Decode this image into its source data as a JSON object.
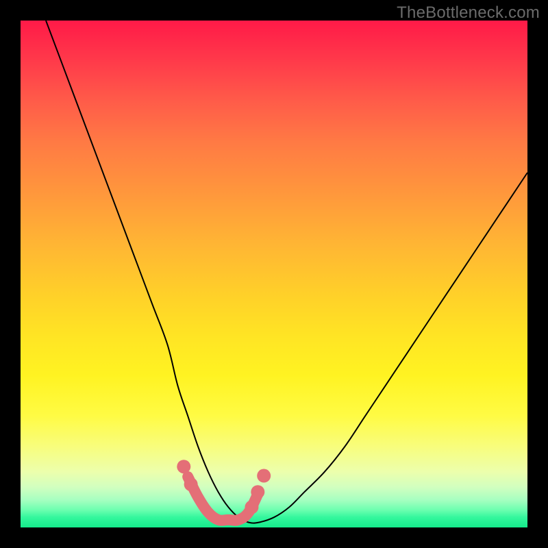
{
  "attribution": "TheBottleneck.com",
  "chart_data": {
    "type": "line",
    "title": "",
    "xlabel": "",
    "ylabel": "",
    "xlim": [
      0,
      100
    ],
    "ylim": [
      0,
      100
    ],
    "background_gradient": {
      "top_color": "#ff1a48",
      "mid_color": "#ffe424",
      "bottom_color": "#14eb8b"
    },
    "series": [
      {
        "name": "bottleneck-curve",
        "color": "#000000",
        "stroke_width": 2,
        "x": [
          5,
          8,
          11,
          14,
          17,
          20,
          23,
          26,
          29,
          31,
          33,
          35,
          37,
          39,
          41,
          43,
          45,
          47,
          50,
          53,
          56,
          60,
          64,
          68,
          72,
          76,
          80,
          84,
          88,
          92,
          96,
          100
        ],
        "y": [
          100,
          92,
          84,
          76,
          68,
          60,
          52,
          44,
          36,
          28,
          22,
          16,
          11,
          7,
          4,
          2,
          1,
          1,
          2,
          4,
          7,
          11,
          16,
          22,
          28,
          34,
          40,
          46,
          52,
          58,
          64,
          70
        ]
      },
      {
        "name": "highlight-band",
        "color": "#e46f77",
        "stroke_width": 16,
        "x": [
          33,
          35,
          37,
          39,
          41,
          43,
          45,
          47
        ],
        "y": [
          10,
          6,
          3,
          1.5,
          1.5,
          1.5,
          3,
          7
        ]
      }
    ],
    "highlight_points": {
      "name": "highlight-dots",
      "color": "#e46f77",
      "radius": 10,
      "x": [
        32.2,
        33.6,
        45.6,
        46.8,
        48.0
      ],
      "y": [
        12.0,
        8.5,
        4.0,
        7.0,
        10.2
      ]
    }
  }
}
